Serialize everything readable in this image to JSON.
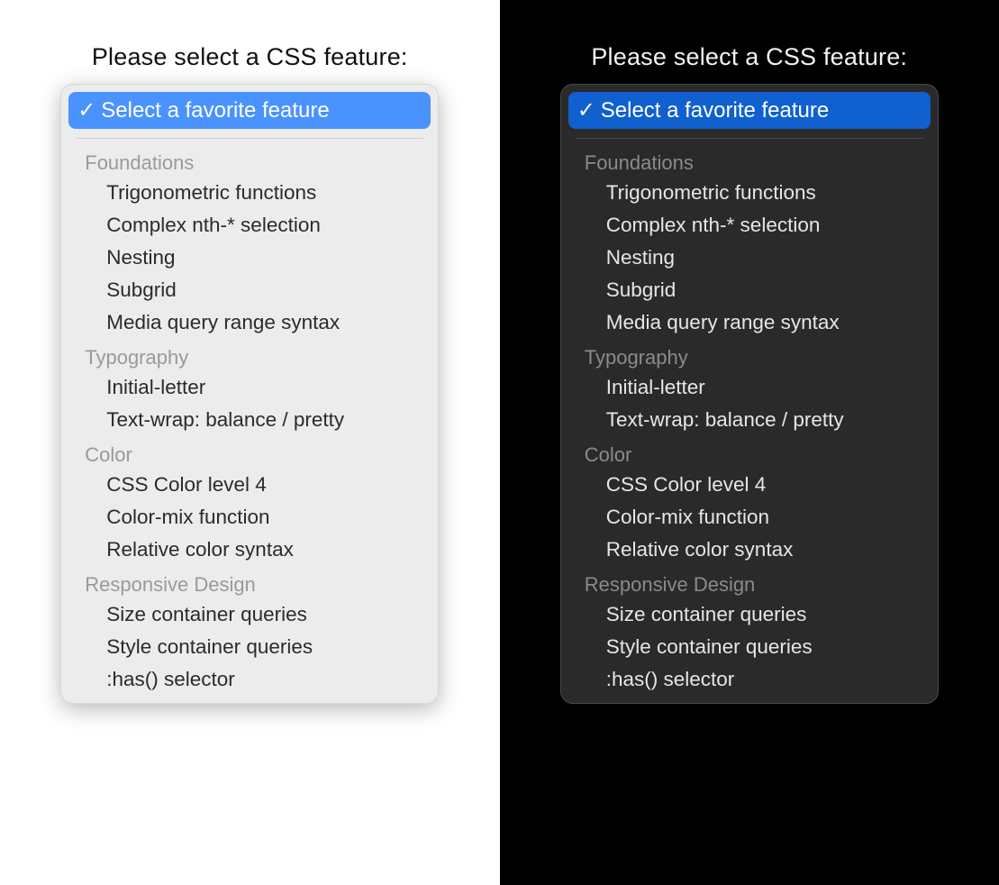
{
  "prompt": "Please select a CSS feature:",
  "selected": "Select a favorite feature",
  "colors": {
    "light_accent": "#4a93ff",
    "dark_accent": "#1060d0"
  },
  "groups": [
    {
      "label": "Foundations",
      "items": [
        "Trigonometric functions",
        "Complex nth-* selection",
        "Nesting",
        "Subgrid",
        "Media query range syntax"
      ]
    },
    {
      "label": "Typography",
      "items": [
        "Initial-letter",
        "Text-wrap: balance / pretty"
      ]
    },
    {
      "label": "Color",
      "items": [
        "CSS Color level 4",
        "Color-mix function",
        "Relative color syntax"
      ]
    },
    {
      "label": "Responsive Design",
      "items": [
        "Size container queries",
        "Style container queries",
        ":has() selector"
      ]
    }
  ]
}
